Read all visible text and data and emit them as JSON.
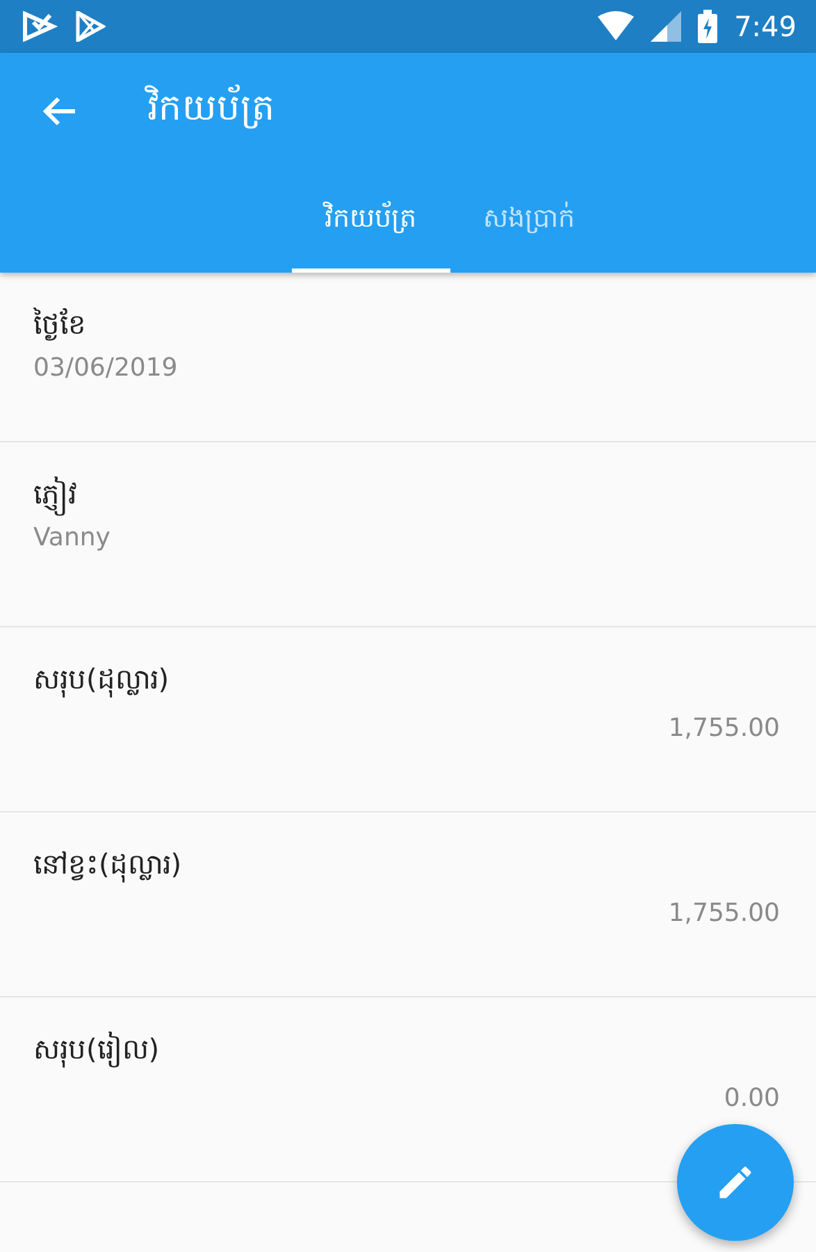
{
  "status_bar": {
    "time": "7:49"
  },
  "app_bar": {
    "title": "វិកយប័ត្រ"
  },
  "tabs": [
    {
      "label": "វិកយប័ត្រ",
      "selected": true
    },
    {
      "label": "សងប្រាក់",
      "selected": false
    }
  ],
  "fields": [
    {
      "kind": "stacked",
      "label": "ថ្ងៃខែ",
      "value": "03/06/2019"
    },
    {
      "kind": "stacked",
      "label": "ភ្ញៀវ",
      "value": "Vanny"
    },
    {
      "kind": "amount",
      "label": "សរុប(ដុល្លារ)",
      "value": "1,755.00"
    },
    {
      "kind": "amount",
      "label": "នៅខ្វះ(ដុល្លារ)",
      "value": "1,755.00"
    },
    {
      "kind": "amount",
      "label": "សរុប(រៀល)",
      "value": "0.00"
    }
  ]
}
